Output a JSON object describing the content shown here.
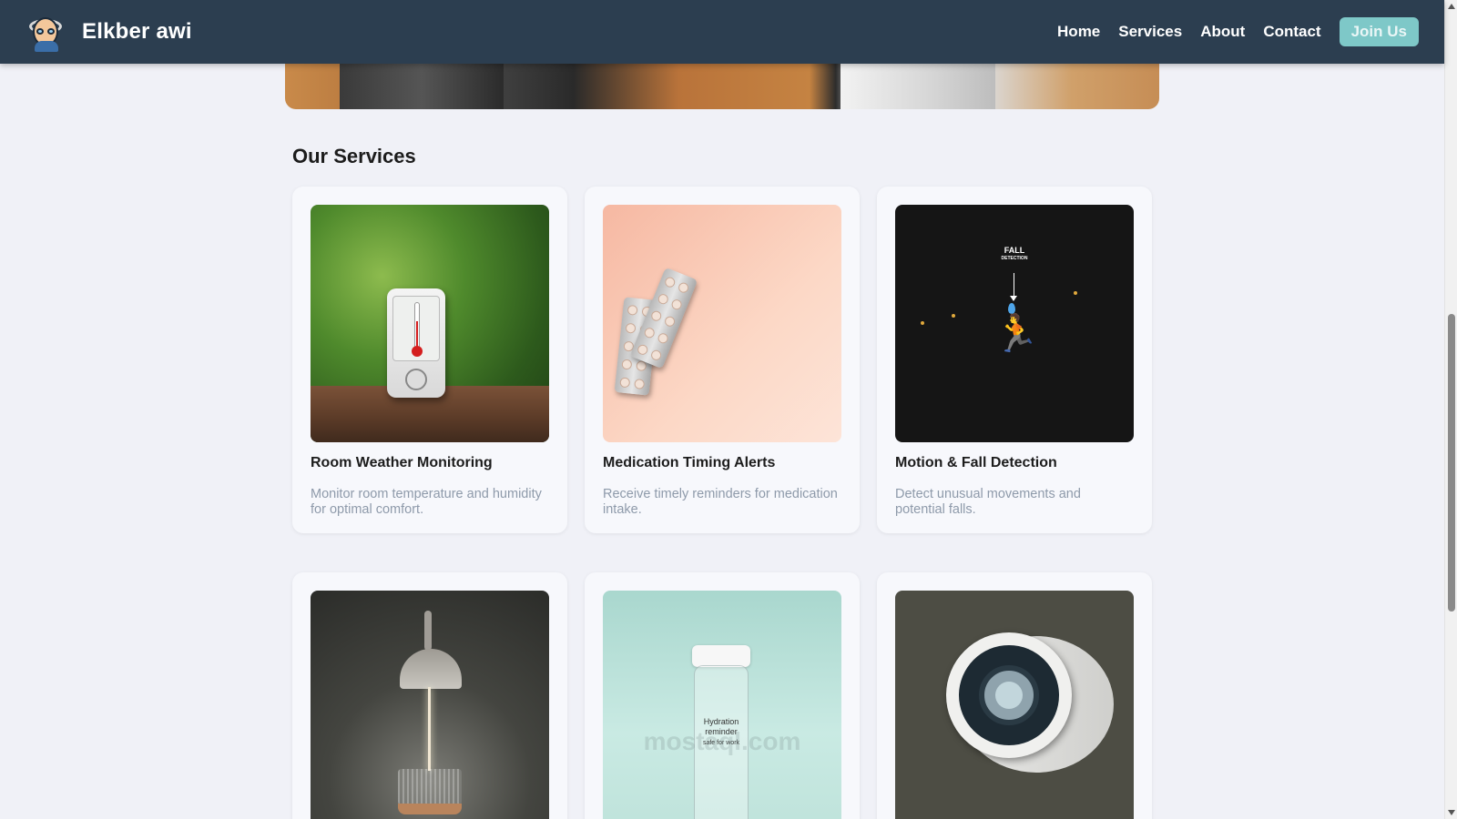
{
  "navbar": {
    "brand": "Elkber awi",
    "links": [
      "Home",
      "Services",
      "About",
      "Contact"
    ],
    "join_label": "Join Us"
  },
  "services": {
    "title": "Our Services",
    "cards": [
      {
        "title": "Room Weather Monitoring",
        "description": "Monitor room temperature and humidity for optimal comfort."
      },
      {
        "title": "Medication Timing Alerts",
        "description": "Receive timely reminders for medication intake."
      },
      {
        "title": "Motion & Fall Detection",
        "description": "Detect unusual movements and potential falls."
      },
      {
        "title": "",
        "description": ""
      },
      {
        "title": "",
        "description": ""
      },
      {
        "title": "",
        "description": ""
      }
    ]
  },
  "images": {
    "fall_title": "FALL",
    "fall_subtitle": "DETECTION",
    "bottle_label": "Hydration reminder",
    "bottle_sub": "safe for work",
    "watermark": "mostaql.com"
  },
  "colors": {
    "navbar": "#2c3e50",
    "accent": "#7ec8c8",
    "background": "#f0f1f7"
  }
}
